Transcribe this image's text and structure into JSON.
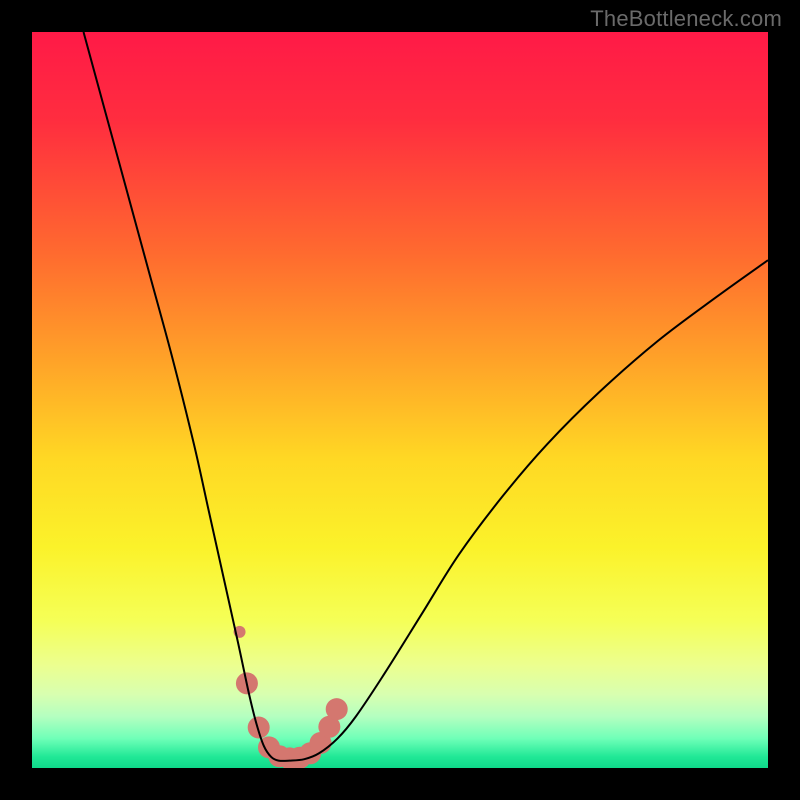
{
  "watermark": "TheBottleneck.com",
  "chart_data": {
    "type": "line",
    "title": "",
    "xlabel": "",
    "ylabel": "",
    "xlim": [
      0,
      100
    ],
    "ylim": [
      0,
      100
    ],
    "background_gradient": {
      "stops": [
        {
          "offset": 0.0,
          "color": "#ff1a47"
        },
        {
          "offset": 0.12,
          "color": "#ff2d3f"
        },
        {
          "offset": 0.3,
          "color": "#ff6a2f"
        },
        {
          "offset": 0.45,
          "color": "#ffa428"
        },
        {
          "offset": 0.58,
          "color": "#ffd824"
        },
        {
          "offset": 0.7,
          "color": "#fbf22a"
        },
        {
          "offset": 0.8,
          "color": "#f5ff57"
        },
        {
          "offset": 0.86,
          "color": "#ecff8f"
        },
        {
          "offset": 0.9,
          "color": "#d8ffb0"
        },
        {
          "offset": 0.93,
          "color": "#b4ffc0"
        },
        {
          "offset": 0.96,
          "color": "#6fffb8"
        },
        {
          "offset": 0.985,
          "color": "#20e896"
        },
        {
          "offset": 1.0,
          "color": "#0fd98a"
        }
      ]
    },
    "series": [
      {
        "name": "bottleneck-curve",
        "color": "#000000",
        "width": 2,
        "x": [
          7,
          10,
          13,
          16,
          19,
          22,
          24,
          26,
          28,
          29.5,
          30.5,
          31.5,
          32.5,
          33.5,
          35,
          37,
          39,
          41.5,
          44,
          48,
          53,
          58,
          64,
          70,
          77,
          85,
          93,
          100
        ],
        "y": [
          100,
          89,
          78,
          67,
          56,
          44,
          35,
          26,
          17,
          10,
          6,
          3,
          1.5,
          1,
          1,
          1.2,
          2,
          4,
          7,
          13,
          21,
          29,
          37,
          44,
          51,
          58,
          64,
          69
        ]
      }
    ],
    "markers": [
      {
        "name": "highlight-band",
        "color": "#d4776f",
        "radius": 11,
        "x": [
          29.2,
          30.8,
          32.2,
          33.6,
          35.0,
          36.4,
          37.8,
          39.2,
          40.4,
          41.4
        ],
        "y": [
          11.5,
          5.5,
          2.8,
          1.6,
          1.3,
          1.4,
          2.0,
          3.4,
          5.6,
          8.0
        ]
      },
      {
        "name": "highlight-dot",
        "color": "#d4776f",
        "radius": 6,
        "x": [
          28.2
        ],
        "y": [
          18.5
        ]
      }
    ]
  }
}
